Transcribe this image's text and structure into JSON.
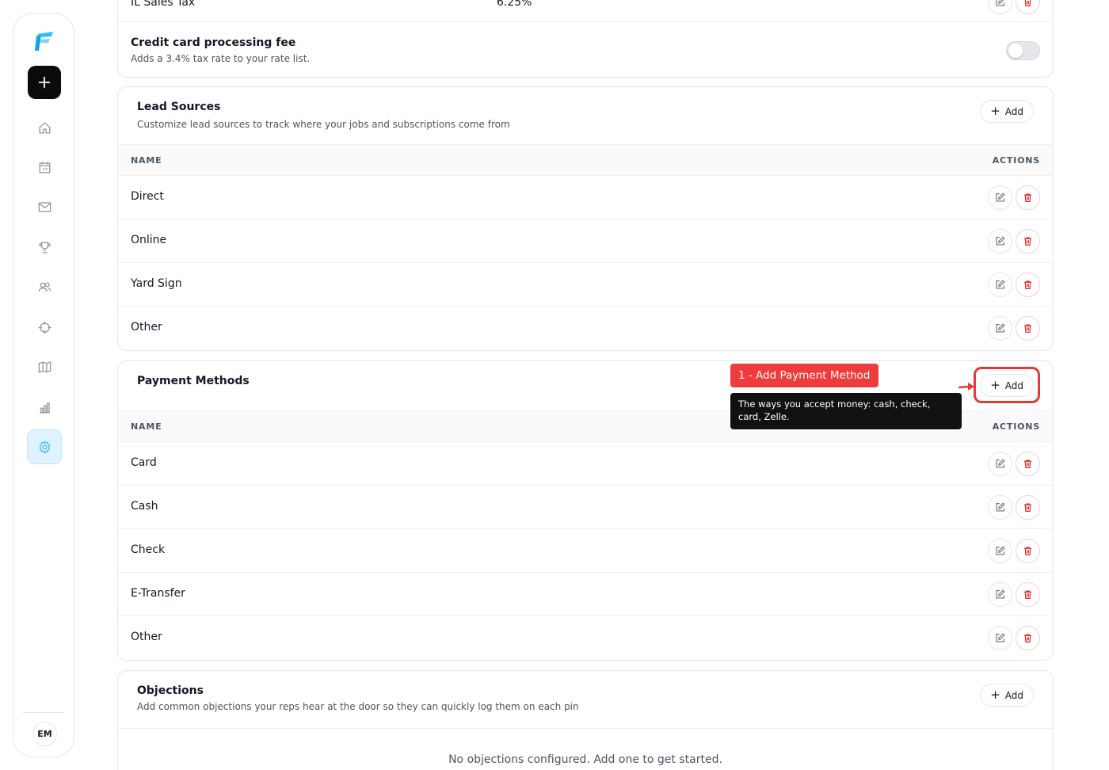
{
  "sidebar": {
    "logo_icon": "app-logo-icon",
    "new_icon": "plus-icon",
    "nav": [
      {
        "icon": "home-icon",
        "active": false
      },
      {
        "icon": "calendar-icon",
        "active": false
      },
      {
        "icon": "mail-icon",
        "active": false
      },
      {
        "icon": "trophy-icon",
        "active": false
      },
      {
        "icon": "users-icon",
        "active": false
      },
      {
        "icon": "crosshair-icon",
        "active": false
      },
      {
        "icon": "map-icon",
        "active": false
      },
      {
        "icon": "bar-chart-icon",
        "active": false
      },
      {
        "icon": "settings-icon",
        "active": true
      }
    ],
    "avatar_initials": "EM"
  },
  "tax": {
    "partial_row_name": "IL Sales Tax",
    "partial_row_rate": "6.25%",
    "fee_title": "Credit card processing fee",
    "fee_desc": "Adds a 3.4% tax rate to your rate list.",
    "fee_enabled": false
  },
  "lead_sources": {
    "title": "Lead Sources",
    "description": "Customize lead sources to track where your jobs and subscriptions come from",
    "add_label": "Add",
    "col_name": "NAME",
    "col_actions": "ACTIONS",
    "rows": [
      "Direct",
      "Online",
      "Yard Sign",
      "Other"
    ]
  },
  "payment_methods": {
    "title": "Payment Methods",
    "add_label": "Add",
    "col_name": "NAME",
    "col_actions": "ACTIONS",
    "rows": [
      "Card",
      "Cash",
      "Check",
      "E-Transfer",
      "Other"
    ]
  },
  "objections": {
    "title": "Objections",
    "description": "Add common objections your reps hear at the door so they can quickly log them on each pin",
    "add_label": "Add",
    "empty_message": "No objections configured. Add one to get started."
  },
  "tour": {
    "step_label": "1 - Add Payment Method",
    "tooltip": "The ways you accept money: cash, check, card, Zelle."
  },
  "colors": {
    "accent": "#38bdf8",
    "danger": "#dc2626",
    "tour_red": "#ef3b3b"
  }
}
